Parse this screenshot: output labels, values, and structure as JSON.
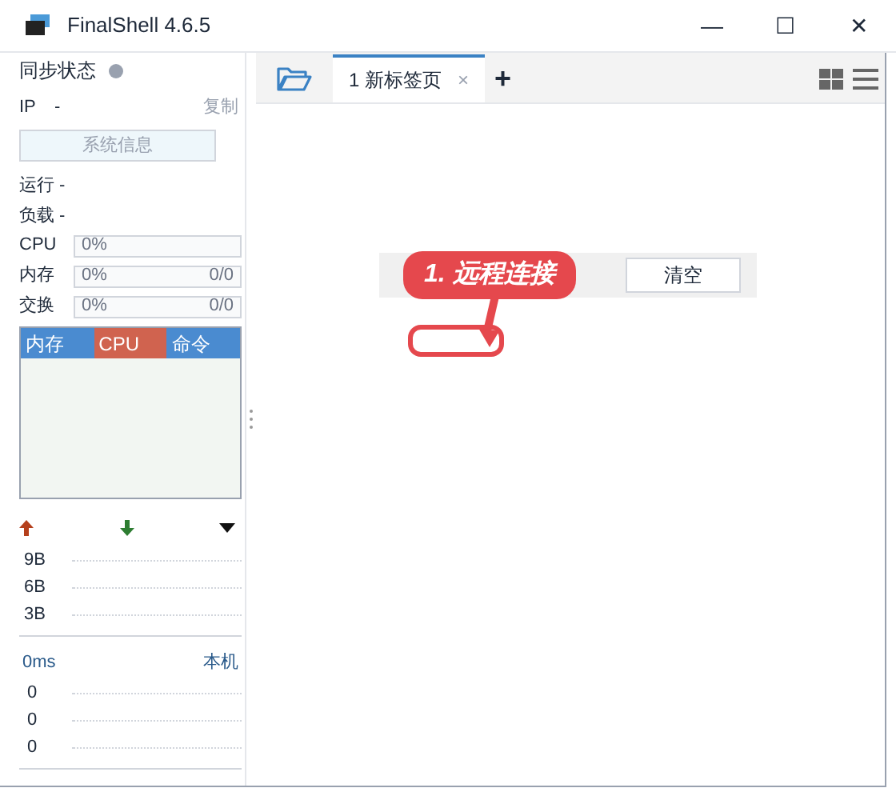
{
  "window": {
    "title": "FinalShell 4.6.5",
    "controls": [
      "—",
      "☐",
      "✕"
    ]
  },
  "sidebar": {
    "sync_label": "同步状态",
    "sync_on": false,
    "ip_label": "IP",
    "ip_value": "-",
    "copy": "复制",
    "sysinfo_button": "系统信息",
    "uptime": "运行 -",
    "load": "负载 -",
    "meters": [
      {
        "label": "CPU",
        "reading": "0%"
      },
      {
        "label": "内存",
        "reading": "0%",
        "detail": "0/0"
      },
      {
        "label": "交换",
        "reading": "0%",
        "detail": "0/0"
      }
    ],
    "process_tabs": [
      {
        "label": "内存",
        "color": "#4a8bd0"
      },
      {
        "label": "CPU",
        "color": "#d0634f"
      },
      {
        "label": "命令",
        "color": "#4a8bd0"
      }
    ],
    "net_ticks": [
      "9B",
      "6B",
      "3B"
    ],
    "ping_label": "0ms",
    "host_label": "本机",
    "ping_ticks": [
      "0",
      "0",
      "0"
    ]
  },
  "tabs": [
    {
      "label": "1 新标签页",
      "selected": true,
      "close": "×"
    }
  ],
  "add_tab": "+",
  "toolbar": {
    "clear_button": "清空"
  },
  "callout": {
    "text": "1. 远程连接"
  }
}
